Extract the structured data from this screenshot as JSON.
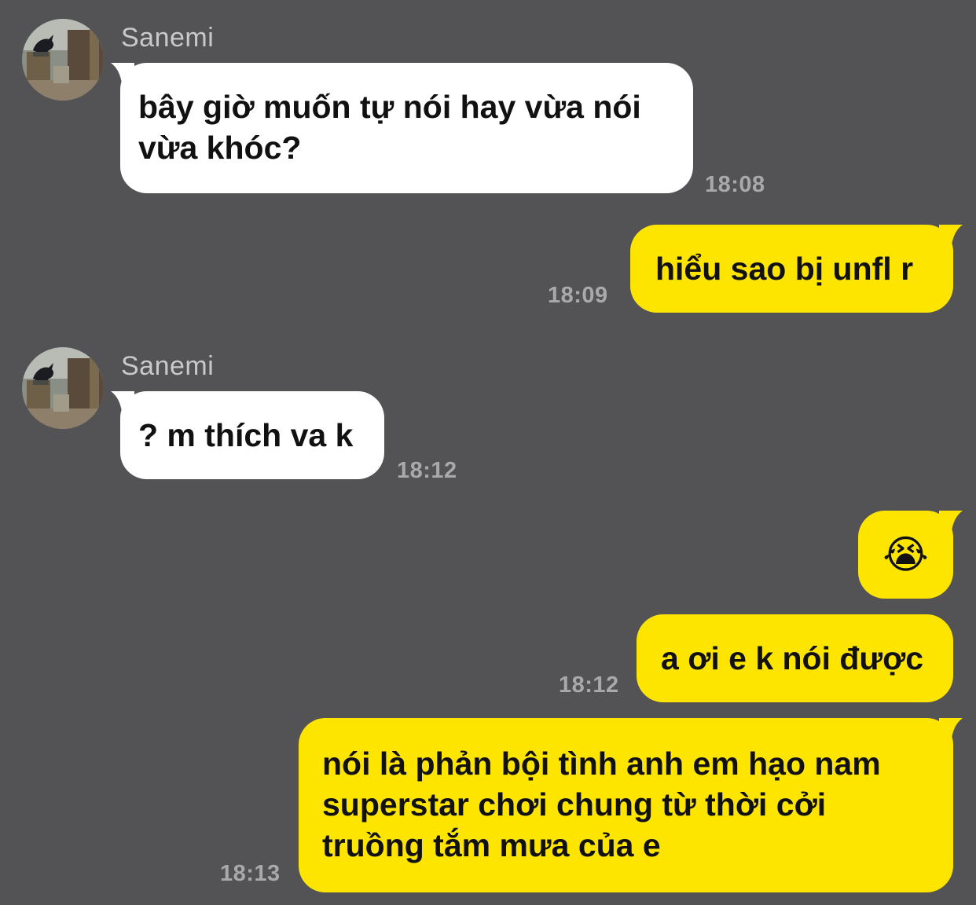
{
  "messages": [
    {
      "sender": "Sanemi",
      "text": "bây giờ muốn tự nói hay vừa nói vừa khóc?",
      "time": "18:08"
    },
    {
      "text": "hiểu sao bị unfl r",
      "time": "18:09"
    },
    {
      "sender": "Sanemi",
      "text": "? m thích va k",
      "time": "18:12"
    },
    {
      "emoji": "😭"
    },
    {
      "text": "a ơi e k nói được",
      "time": "18:12"
    },
    {
      "text": "nói là phản bội tình anh em hạo nam superstar chơi chung từ thời cởi truồng tắm mưa của e",
      "time": "18:13"
    }
  ],
  "colors": {
    "background": "#535254",
    "incoming_bubble": "#ffffff",
    "outgoing_bubble": "#fee500",
    "sender_text": "#c9c9cb",
    "timestamp": "#a9a8ab"
  },
  "icons": {
    "avatar": "crow-on-fence-avatar",
    "bubble_tail": "speech-bubble-tail-icon"
  }
}
